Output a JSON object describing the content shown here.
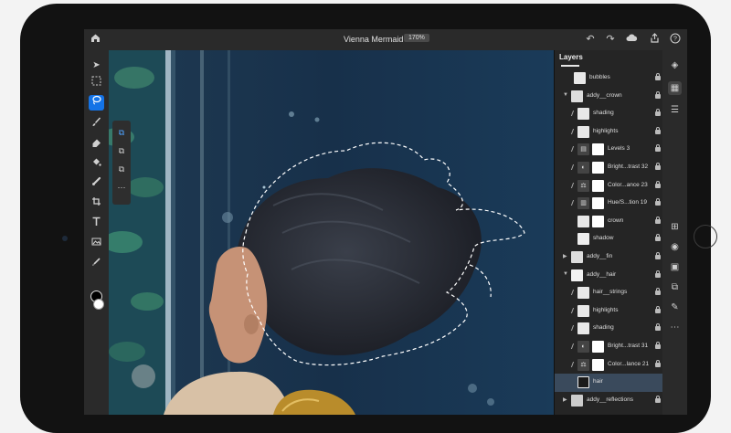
{
  "app": {
    "document_title": "Vienna Mermaid *",
    "zoom": "170%"
  },
  "topbar_icons": [
    "home-icon",
    "undo-icon",
    "redo-icon",
    "cloud-icon",
    "share-icon",
    "help-icon"
  ],
  "tools": [
    "move-tool-icon",
    "marquee-tool-icon",
    "lasso-tool-icon",
    "brush-tool-icon",
    "eraser-tool-icon",
    "fill-tool-icon",
    "healing-tool-icon",
    "crop-tool-icon",
    "type-tool-icon",
    "place-image-icon",
    "eyedropper-tool-icon"
  ],
  "colors": {
    "accent": "#1473e6",
    "foreground": "#000000",
    "background": "#ffffff",
    "selected_row": "#3a4a5c"
  },
  "layers_panel": {
    "title": "Layers",
    "layers": [
      {
        "name": "bubbles"
      },
      {
        "name": "addy__crown"
      },
      {
        "name": "shading"
      },
      {
        "name": "highlights"
      },
      {
        "name": "Levels 3"
      },
      {
        "name": "Bright...trast 32"
      },
      {
        "name": "Color...ance 23"
      },
      {
        "name": "Hue/S...tion 19"
      },
      {
        "name": "crown"
      },
      {
        "name": "shadow"
      },
      {
        "name": "addy__fin"
      },
      {
        "name": "addy__hair"
      },
      {
        "name": "hair__strings"
      },
      {
        "name": "highlights"
      },
      {
        "name": "shading"
      },
      {
        "name": "Bright...trast 31"
      },
      {
        "name": "Color...lance 21"
      },
      {
        "name": "hair"
      },
      {
        "name": "addy__reflections"
      }
    ]
  },
  "right_rail_icons": [
    "layers-icon",
    "layer-properties-icon",
    "adjustments-icon",
    "add-layer-icon",
    "visibility-icon",
    "mask-icon",
    "fx-icon",
    "brush-settings-icon",
    "more-icon"
  ]
}
